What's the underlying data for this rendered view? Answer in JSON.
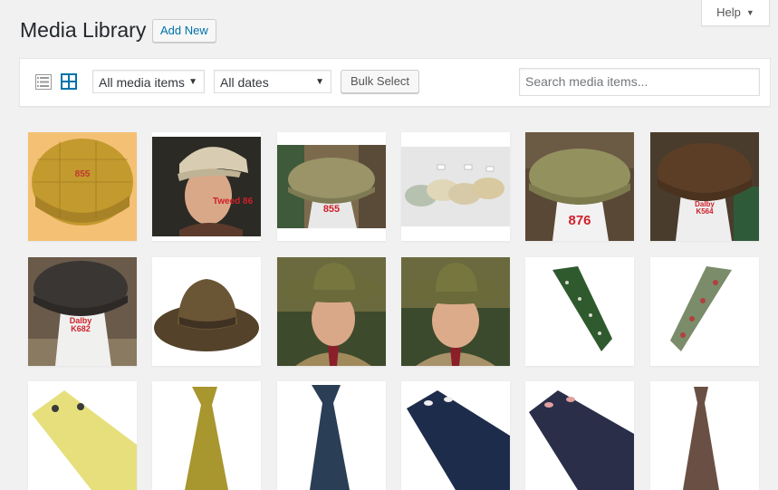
{
  "header": {
    "title": "Media Library",
    "add_new_label": "Add New",
    "help_label": "Help"
  },
  "toolbar": {
    "list_view_icon": "list-view-icon",
    "grid_view_icon": "grid-view-icon",
    "media_filter": "All media items",
    "date_filter": "All dates",
    "bulk_select_label": "Bulk Select",
    "search_placeholder": "Search media items..."
  },
  "media": [
    {
      "subject": "flat-cap-mustard",
      "caption": "855"
    },
    {
      "subject": "man-in-tweed-cap",
      "caption": "Tweed 86"
    },
    {
      "subject": "green-tweed-cap-on-mannequin",
      "caption": "855"
    },
    {
      "subject": "four-caps-on-table",
      "caption": ""
    },
    {
      "subject": "olive-cap-on-mannequin",
      "caption": "876"
    },
    {
      "subject": "brown-cap-on-mannequin",
      "caption": "Dalby\nK564"
    },
    {
      "subject": "dark-cap-on-mannequin",
      "caption": "Dalby\nK682"
    },
    {
      "subject": "brown-fedora",
      "caption": ""
    },
    {
      "subject": "man-in-green-hat-1",
      "caption": ""
    },
    {
      "subject": "man-in-green-hat-2",
      "caption": ""
    },
    {
      "subject": "green-pheasant-tie",
      "caption": ""
    },
    {
      "subject": "grey-pattern-tie",
      "caption": ""
    },
    {
      "subject": "yellow-tie",
      "caption": ""
    },
    {
      "subject": "gold-tie",
      "caption": ""
    },
    {
      "subject": "navy-tie",
      "caption": ""
    },
    {
      "subject": "navy-sheep-tie",
      "caption": ""
    },
    {
      "subject": "navy-pig-tie",
      "caption": ""
    },
    {
      "subject": "brown-tie",
      "caption": ""
    }
  ]
}
